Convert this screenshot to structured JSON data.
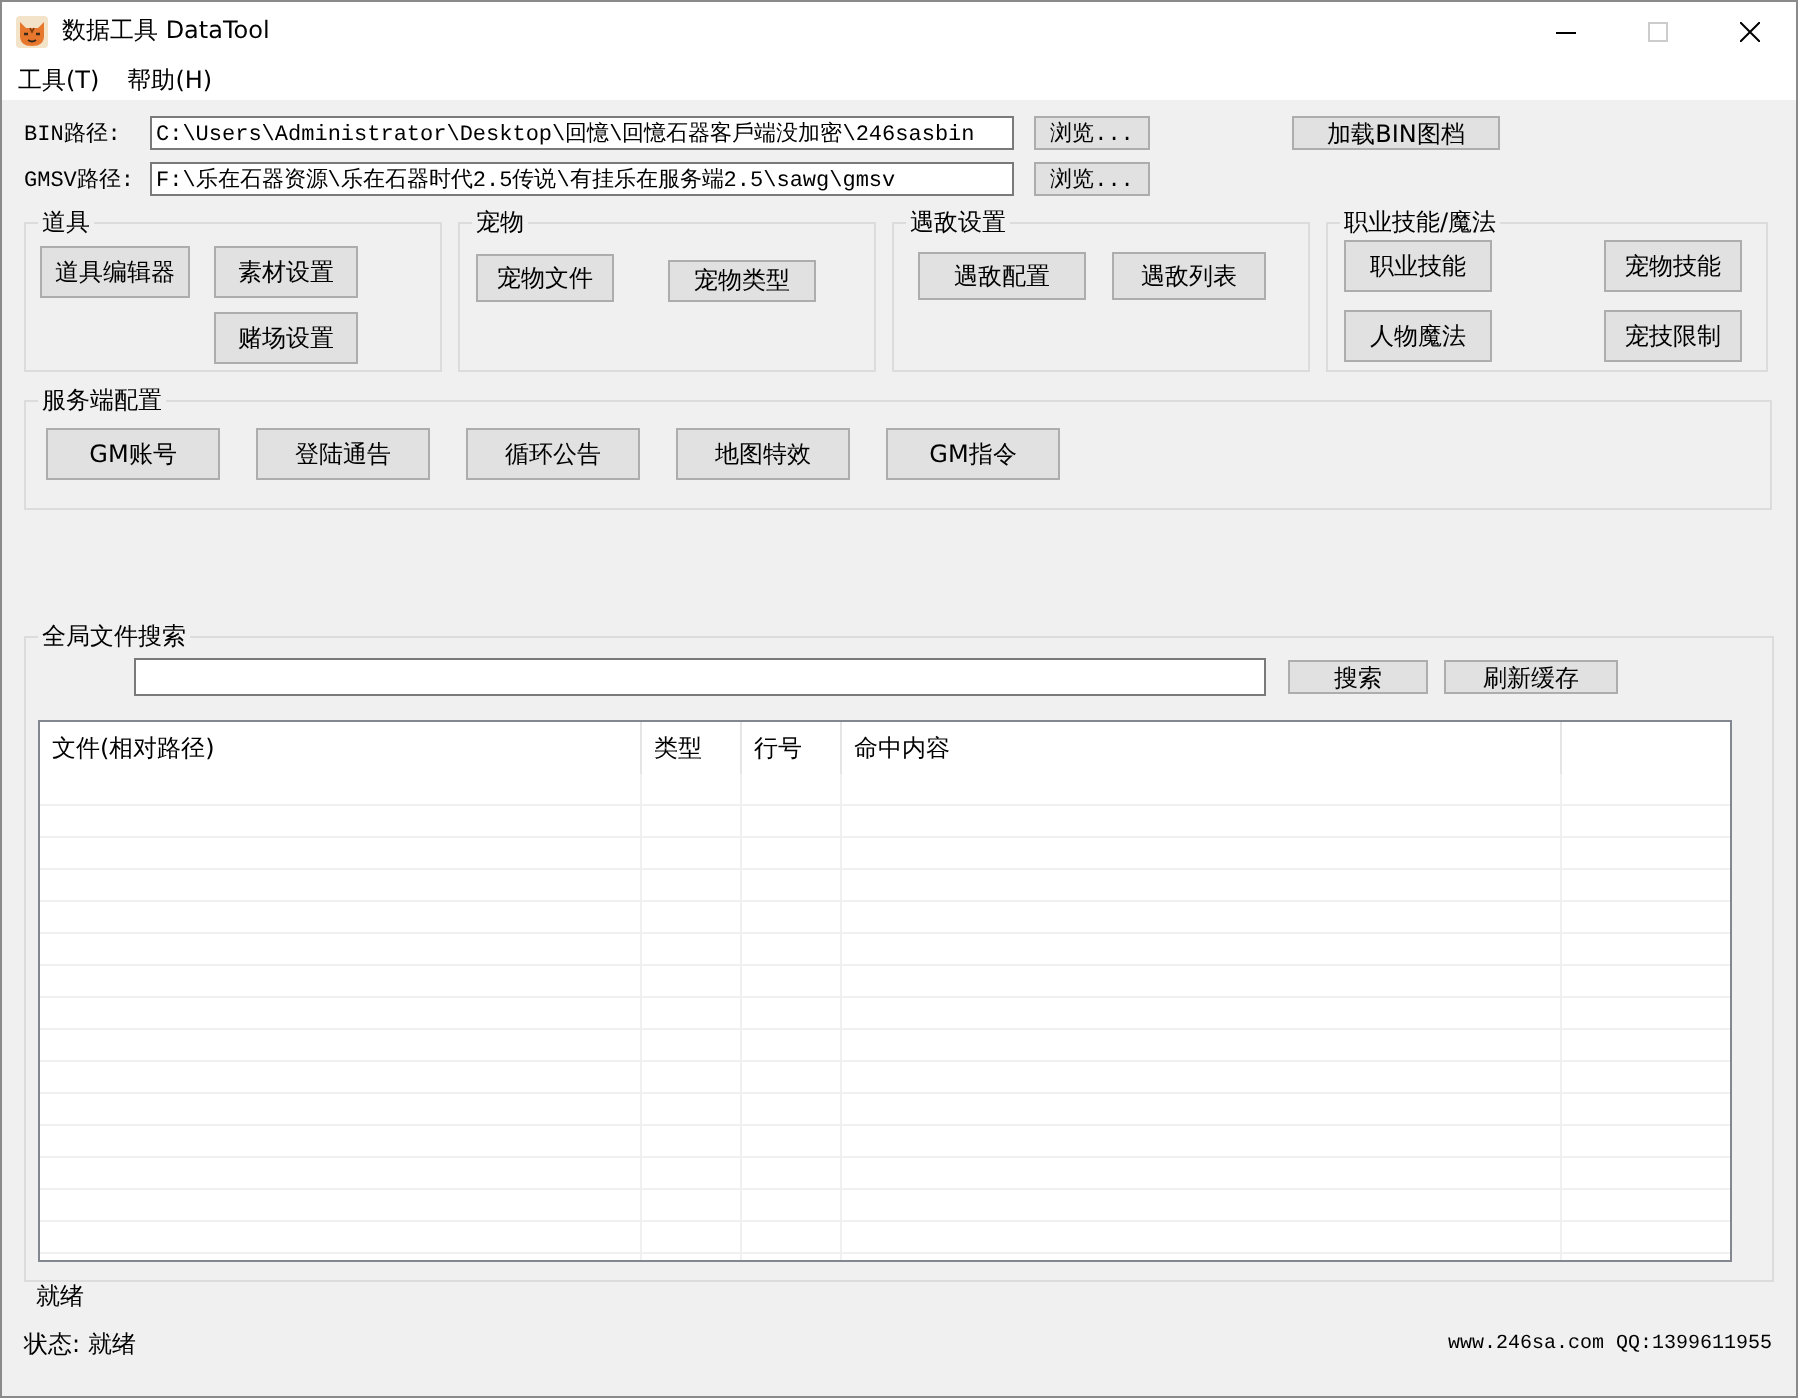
{
  "window": {
    "title": "数据工具 DataTool",
    "maximize_disabled": true
  },
  "menu": [
    {
      "label": "工具(T)"
    },
    {
      "label": "帮助(H)"
    }
  ],
  "paths": [
    {
      "label": "BIN路径:",
      "value": "C:\\Users\\Administrator\\Desktop\\回憶\\回憶石器客戶端没加密\\246sasbin",
      "button": "浏览..."
    },
    {
      "label": "GMSV路径:",
      "value": "F:\\乐在石器资源\\乐在石器时代2.5传说\\有挂乐在服务端2.5\\sawg\\gmsv",
      "button": "浏览..."
    }
  ],
  "load_button": "加载BIN图档",
  "groups": [
    {
      "title": "道具",
      "buttons": [
        "道具编辑器",
        "素材设置",
        "赌场设置"
      ]
    },
    {
      "title": "宠物",
      "buttons": [
        "宠物文件",
        "宠物类型"
      ]
    },
    {
      "title": "遇敌设置",
      "buttons": [
        "遇敌配置",
        "遇敌列表"
      ]
    },
    {
      "title": "职业技能/魔法",
      "buttons": [
        "职业技能",
        "宠物技能",
        "人物魔法",
        "宠技限制"
      ]
    }
  ],
  "server_config": {
    "title": "服务端配置",
    "buttons": [
      "GM账号",
      "登陆通告",
      "循环公告",
      "地图特效",
      "GM指令"
    ]
  },
  "search": {
    "title": "全局文件搜索",
    "buttons": [
      "搜索",
      "刷新缓存"
    ],
    "table": {
      "columns": [
        "文件(相对路径)",
        "类型",
        "行号",
        "命中内容"
      ]
    }
  },
  "log": "就绪",
  "status_bar": {
    "status": "状态: 就绪",
    "contact": "www.246sa.com QQ:1399611955"
  }
}
